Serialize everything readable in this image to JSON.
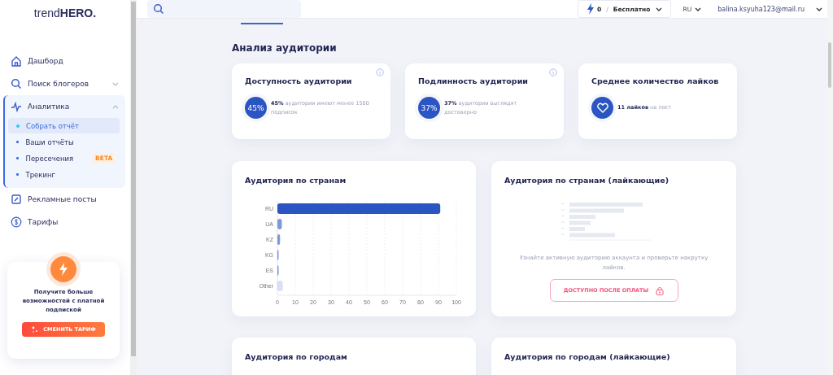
{
  "logo": {
    "text": "trend",
    "bold": "HERO."
  },
  "header": {
    "credits": "0",
    "separator": "/",
    "plan": "Бесплатно",
    "language": "RU",
    "user": "balina.ksyuha123@mail.ru"
  },
  "sidebar": {
    "items": [
      {
        "kind": "link",
        "label": "Дашборд"
      },
      {
        "kind": "dropdown",
        "label": "Поиск блогеров",
        "expanded": false
      },
      {
        "kind": "group",
        "label": "Аналитика",
        "expanded": true,
        "children": [
          {
            "label": "Собрать отчёт",
            "selected": true
          },
          {
            "label": "Ваши отчёты",
            "selected": false
          },
          {
            "label": "Пересечения",
            "selected": false,
            "badge": "BETA"
          },
          {
            "label": "Трекинг",
            "selected": false
          }
        ]
      },
      {
        "kind": "link",
        "label": "Рекламные посты"
      },
      {
        "kind": "link",
        "label": "Тарифы"
      }
    ],
    "promo": {
      "text": "Получите больше возможностей с платной подпиской",
      "button": "СМЕНИТЬ ТАРИФ"
    }
  },
  "page": {
    "title": "Анализ аудитории",
    "stats": [
      {
        "kind": "percent",
        "title": "Доступность аудитории",
        "value": "45%",
        "text": "**45%** аудитории имеют менее 1500 подписок",
        "info": true
      },
      {
        "kind": "percent",
        "title": "Подлинность аудитории",
        "value": "37%",
        "text": "**37%** аудитории выглядят достоверно",
        "info": true
      },
      {
        "kind": "likes",
        "title": "Среднее количество лайков",
        "text": "**11 лайков** на пост",
        "info": false
      }
    ],
    "panels": [
      {
        "kind": "chart",
        "title": "Аудитория по странам",
        "chart_data": {
          "type": "bar",
          "orientation": "horizontal",
          "categories": [
            "RU",
            "UA",
            "KZ",
            "KG",
            "ES",
            "Other"
          ],
          "series": [
            {
              "color": "#2c55c4",
              "values": [
                91,
                2.5,
                1.5,
                0.5,
                0.3,
                3
              ]
            }
          ],
          "grid": true,
          "xlim": [
            0,
            100
          ],
          "xticks": [
            0,
            10,
            20,
            30,
            40,
            50,
            60,
            70,
            80,
            90,
            100
          ]
        }
      },
      {
        "kind": "locked",
        "title": "Аудитория по странам (лайкающие)",
        "text": "Узнайте активную аудиторию аккаунта и проверьте накрутку лайков.",
        "button": "ДОСТУПНО ПОСЛЕ ОПЛАТЫ"
      },
      {
        "kind": "stub",
        "title": "Аудитория по городам"
      },
      {
        "kind": "stub",
        "title": "Аудитория по городам (лайкающие)"
      }
    ]
  }
}
